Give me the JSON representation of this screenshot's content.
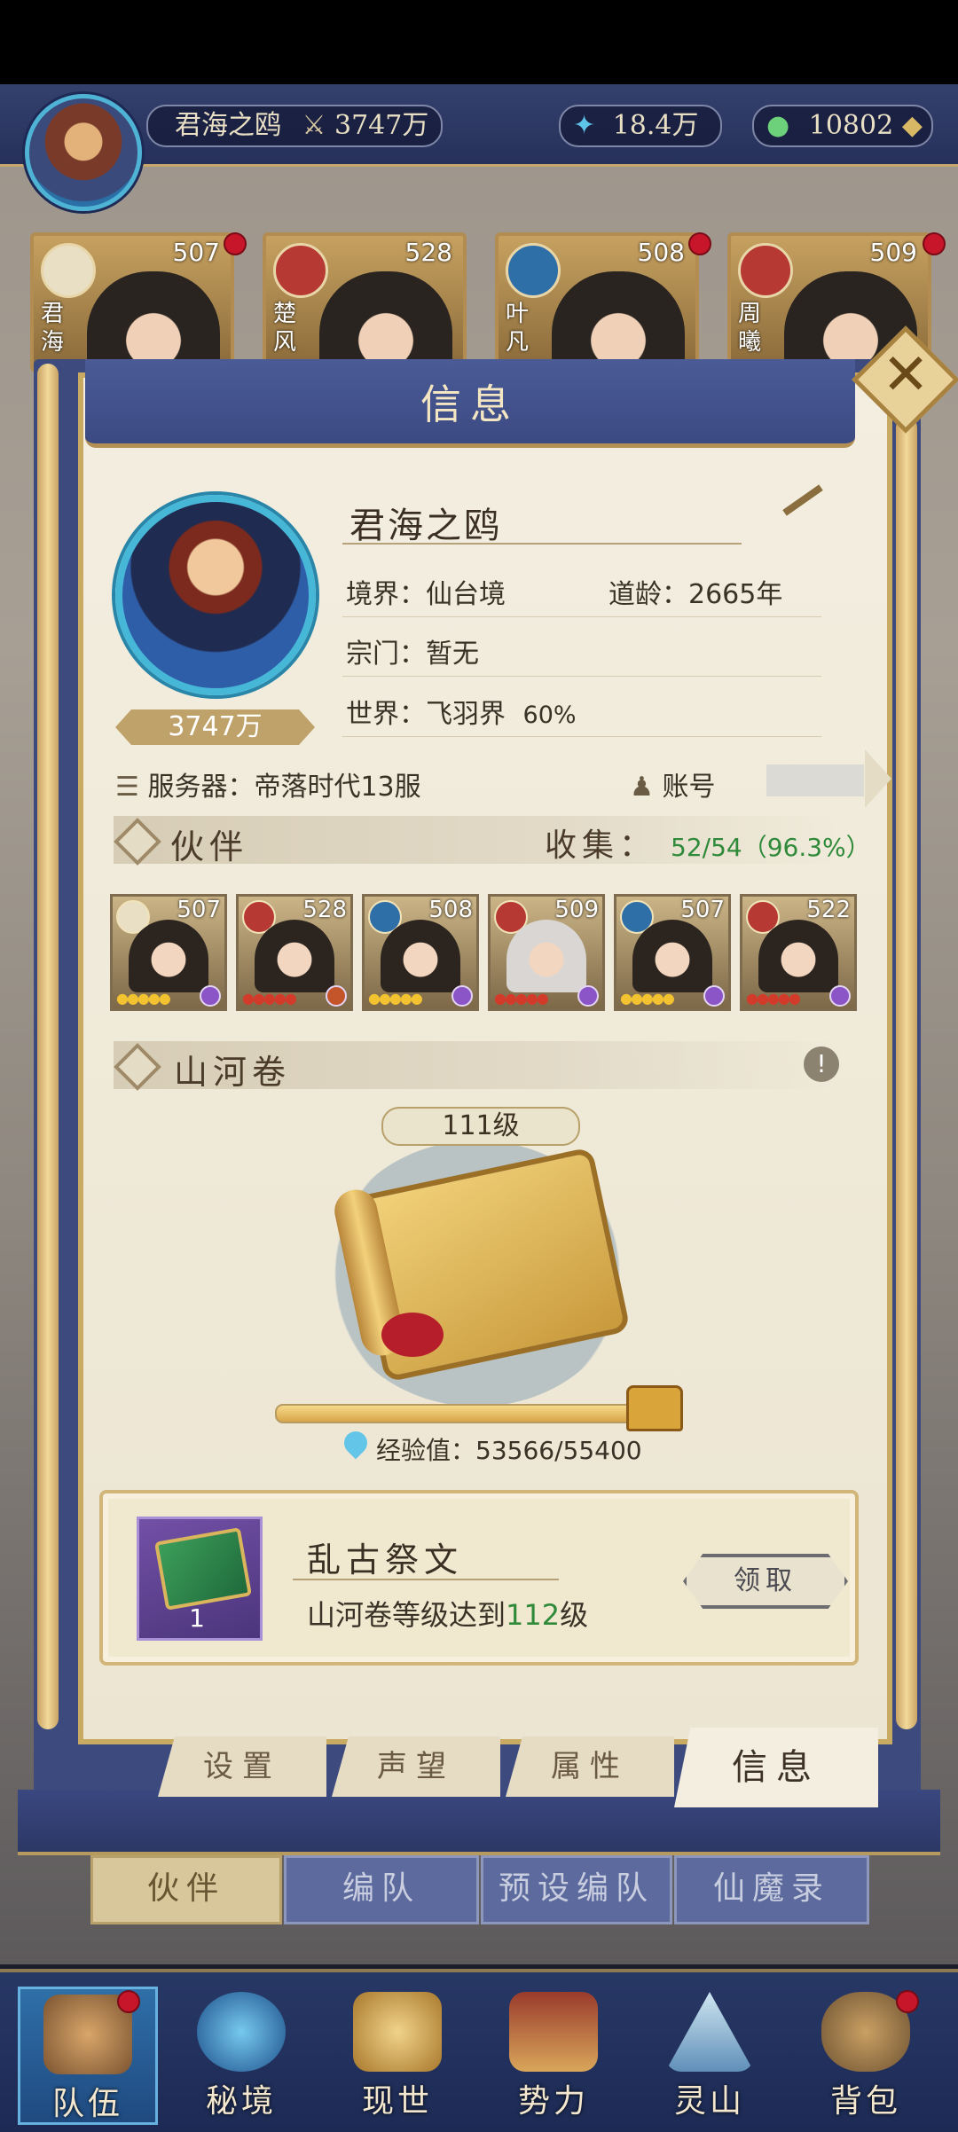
{
  "top_bar": {
    "player_name": "君海之鸥",
    "power": "3747万",
    "currency_crystal": "18.4万",
    "currency_jade": "10802"
  },
  "background_cards": [
    {
      "name": "君海",
      "level": "507"
    },
    {
      "name": "楚风",
      "level": "528"
    },
    {
      "name": "叶凡",
      "level": "508"
    },
    {
      "name": "周曦",
      "level": "509"
    }
  ],
  "panel": {
    "title": "信息",
    "profile": {
      "name": "君海之鸥",
      "realm": "境界：仙台境",
      "age": "道龄：2665年",
      "sect": "宗门：暂无",
      "world": "世界：飞羽界",
      "world_pct": "60%",
      "power": "3747万",
      "server": "服务器：帝落时代13服",
      "account_label": "账号"
    },
    "partners_section": {
      "title": "伙伴",
      "collect_label": "收集：",
      "collect_value": "52/54（96.3%）",
      "cards": [
        {
          "level": "507"
        },
        {
          "level": "528"
        },
        {
          "level": "508"
        },
        {
          "level": "509"
        },
        {
          "level": "507"
        },
        {
          "level": "522"
        }
      ]
    },
    "scroll_section": {
      "title": "山河卷",
      "level": "111级",
      "xp_label": "经验值：",
      "xp_value": "53566/55400",
      "xp_fraction": 0.967
    },
    "reward": {
      "title": "乱古祭文",
      "desc_prefix": "山河卷等级达到",
      "desc_level": "112",
      "desc_suffix": "级",
      "qty": "1",
      "claim_label": "领取"
    },
    "tabs": [
      "设置",
      "声望",
      "属性",
      "信息"
    ]
  },
  "sub_tabs": [
    "伙伴",
    "编队",
    "预设编队",
    "仙魔录"
  ],
  "bottom_nav": [
    "队伍",
    "秘境",
    "现世",
    "势力",
    "灵山",
    "背包"
  ],
  "colors": {
    "accent_blue": "#3c4a82",
    "gold": "#c9aa63",
    "parchment": "#ece5d2",
    "green_value": "#2f8a3a",
    "red_dot": "#c7152a"
  }
}
